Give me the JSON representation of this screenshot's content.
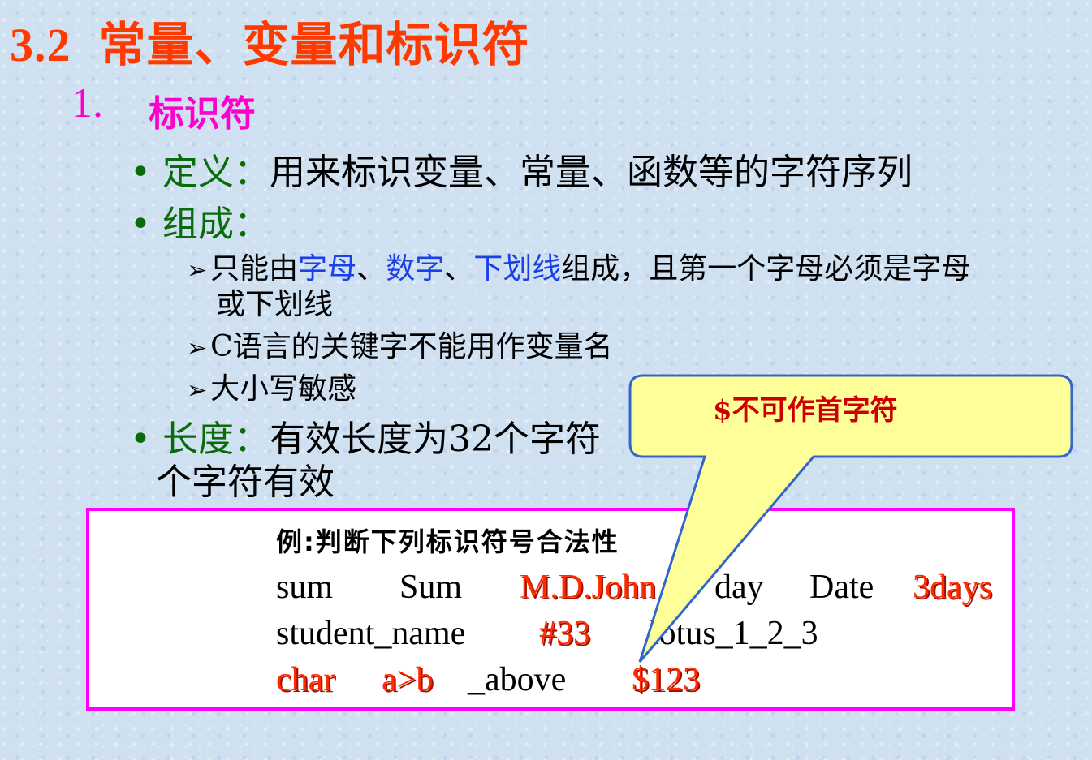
{
  "title": {
    "number": "3.2",
    "text": "常量、变量和标识符"
  },
  "section": {
    "number": "1.",
    "title": "标识符"
  },
  "bullets": {
    "definition": {
      "label": "定义：",
      "text": "用来标识变量、常量、函数等的字符序列"
    },
    "composition": {
      "label": "组成："
    },
    "rules": {
      "rule1_pre": "只能由",
      "rule1_letters": "字母",
      "rule1_sep1": "、",
      "rule1_digits": "数字",
      "rule1_sep2": "、",
      "rule1_underscore": "下划线",
      "rule1_post": "组成，且第一个字母必须是字母",
      "rule1_line2": "或下划线",
      "rule2": "C语言的关键字不能用作变量名",
      "rule3": "大小写敏感"
    },
    "length": {
      "label": "长度：",
      "text": "有效长度为32个字符",
      "line2": "个字符有效"
    }
  },
  "example": {
    "title": "例:判断下列标识符号合法性",
    "row1": [
      "sum",
      "Sum",
      "M.D.John",
      "day",
      "Date",
      "3days"
    ],
    "row2": [
      "student_name",
      "#33",
      "lotus_1_2_3"
    ],
    "row3": [
      "char",
      "a>b",
      "_above",
      "$123"
    ]
  },
  "callout": {
    "text": "$不可作首字符"
  },
  "colors": {
    "title": "#ff3a00",
    "section": "#ff00cc",
    "label_green": "#0a6b0a",
    "highlight_blue": "#1a40e8",
    "invalid_red": "#ff2a00",
    "box_border": "#ff00ff",
    "callout_fill": "#ffff99",
    "callout_border": "#3366cc"
  }
}
